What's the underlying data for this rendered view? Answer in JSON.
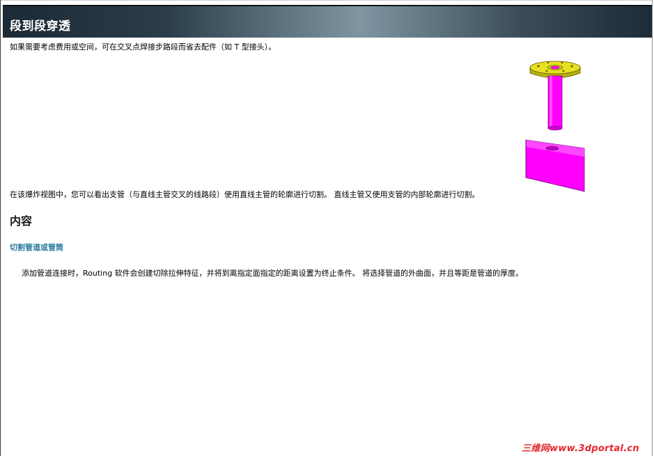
{
  "header": {
    "title": "段到段穿透"
  },
  "content": {
    "intro": "如果需要考虑费用或空间，可在交叉点焊接步路段而省去配件（如 T 型接头）。",
    "explanation": "在该爆炸视图中，您可以看出支管（与直线主管交叉的线路段）使用直线主管的轮廓进行切割。 直线主管又使用支管的内部轮廓进行切割。",
    "section_heading": "内容",
    "sub_link": "切割管道或管筒",
    "body": "添加管道连接时，Routing 软件会创建切除拉伸特征，并将到离指定面指定的距离设置为终止条件。 将选择管道的外曲面，并且等距是管道的厚度。"
  },
  "watermark": "三维网www.3dportal.cn",
  "colors": {
    "link": "#2a7aa0",
    "flange": "#e8e020",
    "pipe": "#ff00ff",
    "watermark": "#e2262a"
  }
}
